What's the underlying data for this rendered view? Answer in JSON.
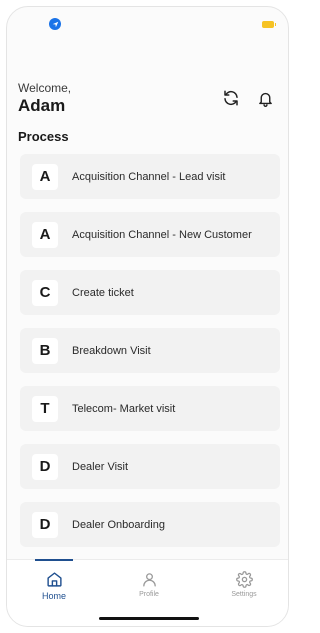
{
  "status_bar": {
    "location_icon": "location-arrow-icon",
    "battery_icon": "battery-icon",
    "battery_color": "#f6c324"
  },
  "header": {
    "welcome": "Welcome,",
    "username": "Adam",
    "refresh_icon": "refresh-icon",
    "bell_icon": "bell-icon"
  },
  "section": {
    "title": "Process"
  },
  "processes": [
    {
      "letter": "A",
      "label": "Acquisition Channel - Lead visit"
    },
    {
      "letter": "A",
      "label": "Acquisition Channel - New Customer"
    },
    {
      "letter": "C",
      "label": "Create ticket"
    },
    {
      "letter": "B",
      "label": "Breakdown Visit"
    },
    {
      "letter": "T",
      "label": "Telecom- Market visit"
    },
    {
      "letter": "D",
      "label": "Dealer Visit"
    },
    {
      "letter": "D",
      "label": "Dealer Onboarding"
    }
  ],
  "tab_bar": {
    "tabs": [
      {
        "label": "Home",
        "icon": "home-icon",
        "active": true
      },
      {
        "label": "Profile",
        "icon": "user-icon",
        "active": false
      },
      {
        "label": "Settings",
        "icon": "gear-icon",
        "active": false
      }
    ]
  },
  "colors": {
    "accent": "#1f4f8f",
    "card_bg": "#f2f2f2",
    "location_blue": "#1a73e8"
  }
}
